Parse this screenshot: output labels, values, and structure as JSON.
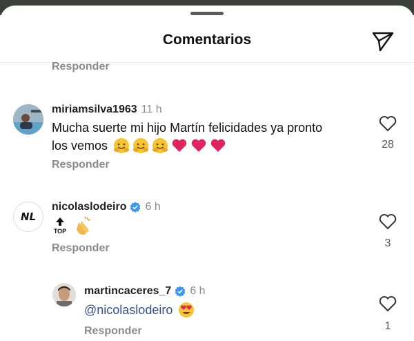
{
  "header": {
    "title": "Comentarios",
    "send_icon": "send-paper-plane-icon"
  },
  "reply_label": "Responder",
  "comments": [
    {
      "username": "miriamsilva1963",
      "time": "11 h",
      "verified": false,
      "text_line1": "Mucha suerte mi hijo Martín felicidades ya pronto",
      "text_line2": "los vemos",
      "emojis": [
        "hugging-face-emoji",
        "hugging-face-emoji",
        "hugging-face-emoji",
        "red-heart-emoji",
        "red-heart-emoji",
        "red-heart-emoji"
      ],
      "likes": "28"
    },
    {
      "username": "nicolaslodeiro",
      "time": "6 h",
      "verified": true,
      "avatar_text": "NL",
      "top_label": "TOP",
      "emojis": [
        "top-arrow-emoji",
        "clapping-hands-emoji"
      ],
      "likes": "3"
    },
    {
      "username": "martincaceres_7",
      "time": "6 h",
      "verified": true,
      "mention": "@nicolaslodeiro",
      "emojis": [
        "heart-eyes-emoji"
      ],
      "likes": "1"
    }
  ],
  "colors": {
    "accent_verified": "#3897f0",
    "heart_red": "#e0245e",
    "muted": "#8a8a8a"
  }
}
